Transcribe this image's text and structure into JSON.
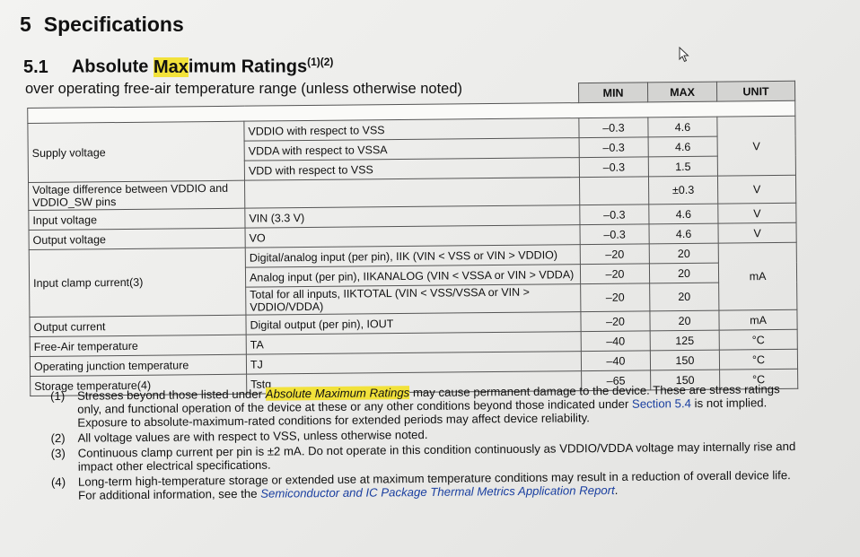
{
  "section": {
    "num": "5",
    "title": "Specifications"
  },
  "subsection": {
    "num": "5.1",
    "title_plain1": "Absolute ",
    "title_hl": "Max",
    "title_plain2": "imum Ratings",
    "sup": "(1)(2)"
  },
  "intro": "over operating free-air temperature range (unless otherwise noted)",
  "headers": {
    "min": "MIN",
    "max": "MAX",
    "unit": "UNIT"
  },
  "rows": [
    {
      "p": "Supply voltage",
      "c": "VDDIO with respect to VSS",
      "min": "–0.3",
      "max": "4.6",
      "unit": "V"
    },
    {
      "c": "VDDA with respect to VSSA",
      "min": "–0.3",
      "max": "4.6"
    },
    {
      "c": "VDD with respect to VSS",
      "min": "–0.3",
      "max": "1.5"
    },
    {
      "p": "Voltage difference between VDDIO and VDDIO_SW pins",
      "c": "",
      "min": "",
      "max": "±0.3",
      "unit": "V"
    },
    {
      "p": "Input voltage",
      "c": "VIN (3.3 V)",
      "min": "–0.3",
      "max": "4.6",
      "unit": "V"
    },
    {
      "p": "Output voltage",
      "c": "VO",
      "min": "–0.3",
      "max": "4.6",
      "unit": "V"
    },
    {
      "p": "Input clamp current(3)",
      "c": "Digital/analog input (per pin), IIK (VIN < VSS or VIN > VDDIO)",
      "min": "–20",
      "max": "20",
      "unit": "mA"
    },
    {
      "c": "Analog input (per pin), IIKANALOG (VIN < VSSA or VIN > VDDA)",
      "min": "–20",
      "max": "20"
    },
    {
      "c": "Total for all inputs, IIKTOTAL (VIN < VSS/VSSA or VIN > VDDIO/VDDA)",
      "min": "–20",
      "max": "20"
    },
    {
      "p": "Output current",
      "c": "Digital output (per pin), IOUT",
      "min": "–20",
      "max": "20",
      "unit": "mA"
    },
    {
      "p": "Free-Air temperature",
      "c": "TA",
      "min": "–40",
      "max": "125",
      "unit": "°C"
    },
    {
      "p": "Operating junction temperature",
      "c": "TJ",
      "min": "–40",
      "max": "150",
      "unit": "°C"
    },
    {
      "p": "Storage temperature(4)",
      "c": "Tstg",
      "min": "–65",
      "max": "150",
      "unit": "°C"
    }
  ],
  "notes": [
    {
      "n": "(1)",
      "t1": "Stresses beyond those listed under ",
      "t_italic": "Absolute Maximum Ratings",
      "t2": " may cause permanent damage to the device. These are stress ratings only, and functional operation of the device at these or any other conditions beyond those indicated under ",
      "link": "Section 5.4",
      "t3": " is not implied. Exposure to absolute-maximum-rated conditions for extended periods may affect device reliability."
    },
    {
      "n": "(2)",
      "t1": "All voltage values are with respect to VSS, unless otherwise noted."
    },
    {
      "n": "(3)",
      "t1": "Continuous clamp current per pin is ±2 mA. Do not operate in this condition continuously as VDDIO/VDDA voltage may internally rise and impact other electrical specifications."
    },
    {
      "n": "(4)",
      "t1": "Long-term high-temperature storage or extended use at maximum temperature conditions may result in a reduction of overall device life. For additional information, see the ",
      "link": "Semiconductor and IC Package Thermal Metrics Application Report",
      "t3": "."
    }
  ]
}
